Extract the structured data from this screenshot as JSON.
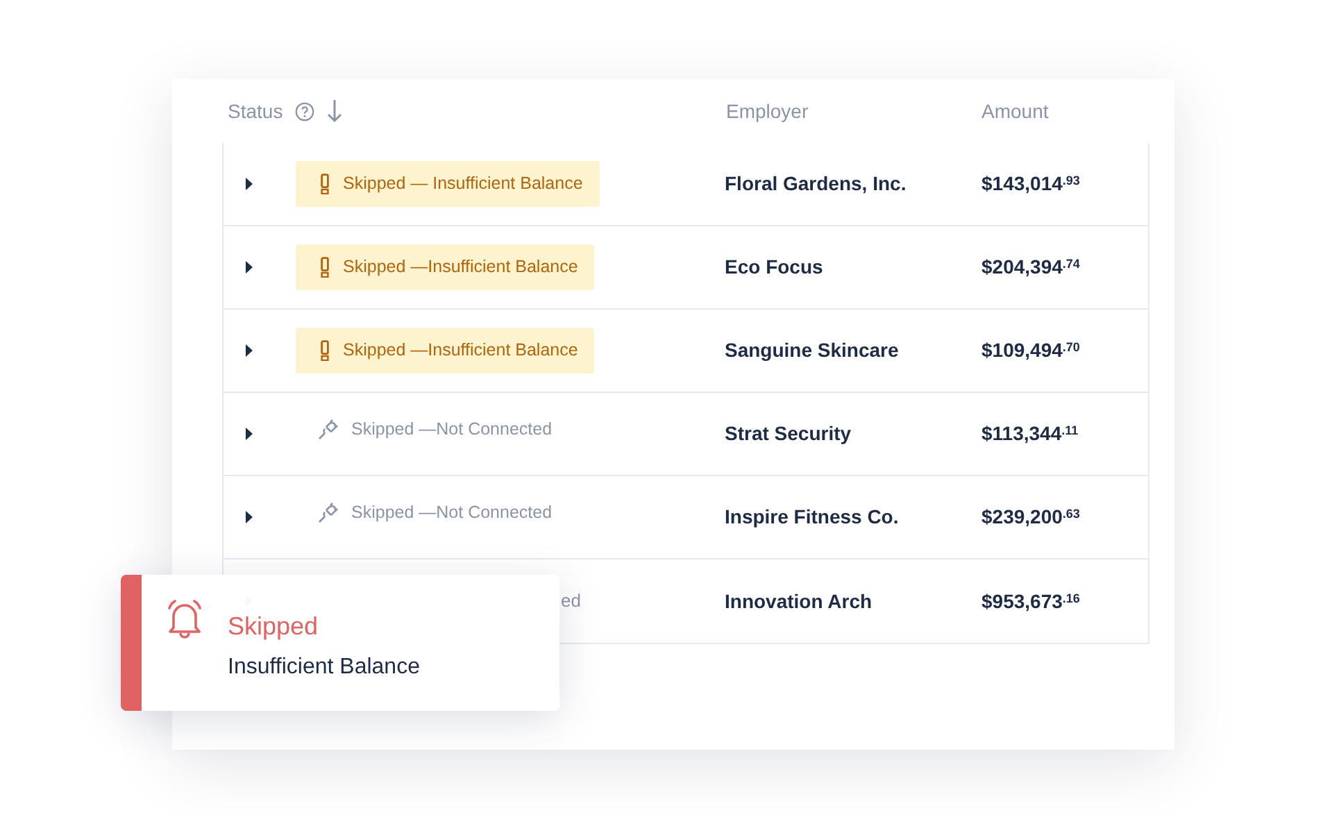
{
  "table": {
    "columns": [
      {
        "label": "Status",
        "help": true,
        "sorted": true
      },
      {
        "label": "Employer"
      },
      {
        "label": "Amount"
      }
    ],
    "rows": [
      {
        "status": {
          "kind": "warning",
          "text": "Skipped — Insufficient Balance"
        },
        "employer": "Floral Gardens, Inc.",
        "amount": "$143,014$^{.93}$"
      },
      {
        "status": {
          "kind": "warning",
          "text": "Skipped —Insufficient Balance"
        },
        "employer": "Eco Focus",
        "amount": "$204,394$^{.74}$"
      },
      {
        "status": {
          "kind": "warning",
          "text": "Skipped —Insufficient Balance"
        },
        "employer": "Sanguine Skincare",
        "amount": "$109,494$^{.70}$"
      },
      {
        "status": {
          "kind": "disconnected",
          "text": "Skipped —Not Connected"
        },
        "employer": "Strat Security",
        "amount": "$113,344$^{.11}$"
      },
      {
        "status": {
          "kind": "disconnected",
          "text": "Skipped —Not Connected"
        },
        "employer": "Inspire Fitness Co.",
        "amount": "$239,200$^{.63}$"
      },
      {
        "status": {
          "kind": "hidden",
          "text": "ed"
        },
        "employer": "Innovation Arch",
        "amount": "$953,673$^{.16}$"
      }
    ]
  },
  "toast": {
    "title": "Skipped",
    "message": "Insufficient Balance"
  }
}
